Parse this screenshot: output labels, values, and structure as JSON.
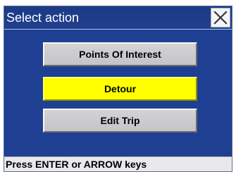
{
  "dialog": {
    "title": "Select action",
    "close_icon": "close-x-icon"
  },
  "actions": [
    {
      "label": "Points Of Interest",
      "highlighted": false
    },
    {
      "label": "Detour",
      "highlighted": true,
      "highlight_color": "#ffff00"
    },
    {
      "label": "Edit Trip",
      "highlighted": false
    }
  ],
  "status": {
    "text": "Press ENTER or ARROW keys"
  },
  "colors": {
    "window_background": "#1f3f92",
    "button_background": "#d3d3d6",
    "status_background": "#e9e9e9"
  }
}
